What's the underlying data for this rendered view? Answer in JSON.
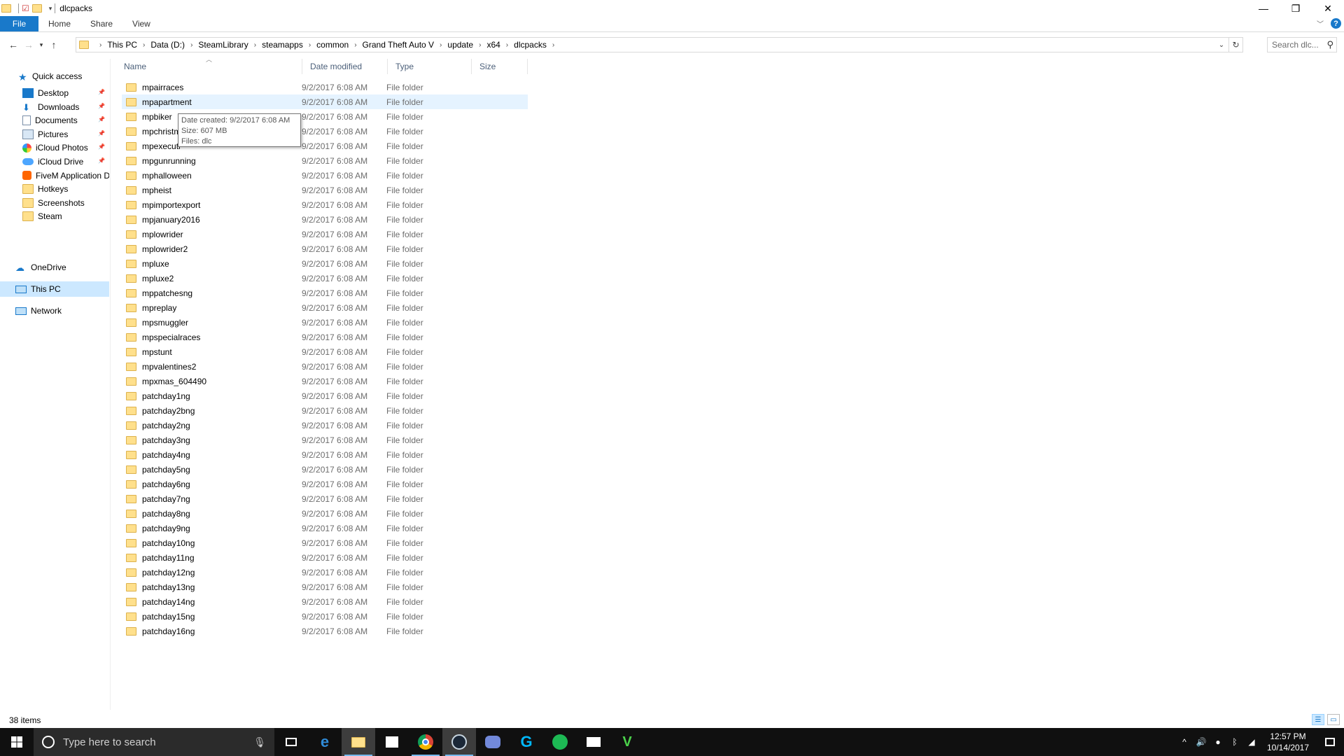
{
  "window": {
    "title": "dlcpacks",
    "controls": {
      "minimize": "—",
      "maximize": "❐",
      "close": "✕"
    }
  },
  "ribbon": {
    "tabs": [
      "File",
      "Home",
      "Share",
      "View"
    ],
    "help": "?"
  },
  "address": {
    "crumbs": [
      "This PC",
      "Data (D:)",
      "SteamLibrary",
      "steamapps",
      "common",
      "Grand Theft Auto V",
      "update",
      "x64",
      "dlcpacks"
    ],
    "search_placeholder": "Search dlc..."
  },
  "nav": {
    "quick_access": "Quick access",
    "pinned": [
      {
        "label": "Desktop",
        "icon": "desktop-icon",
        "pinned": true
      },
      {
        "label": "Downloads",
        "icon": "downloads-icon",
        "pinned": true
      },
      {
        "label": "Documents",
        "icon": "documents-icon",
        "pinned": true
      },
      {
        "label": "Pictures",
        "icon": "pictures-icon",
        "pinned": true
      },
      {
        "label": "iCloud Photos",
        "icon": "icloud-photos-icon",
        "pinned": true
      },
      {
        "label": "iCloud Drive",
        "icon": "icloud-drive-icon",
        "pinned": true
      },
      {
        "label": "FiveM Application D",
        "icon": "fivem-icon",
        "pinned": false
      },
      {
        "label": "Hotkeys",
        "icon": "folder-icon",
        "pinned": false
      },
      {
        "label": "Screenshots",
        "icon": "folder-icon",
        "pinned": false
      },
      {
        "label": "Steam",
        "icon": "folder-icon",
        "pinned": false
      }
    ],
    "onedrive": "OneDrive",
    "this_pc": "This PC",
    "network": "Network"
  },
  "columns": {
    "name": "Name",
    "date": "Date modified",
    "type": "Type",
    "size": "Size"
  },
  "files": [
    {
      "name": "mpairraces",
      "date": "9/2/2017 6:08 AM",
      "type": "File folder"
    },
    {
      "name": "mpapartment",
      "date": "9/2/2017 6:08 AM",
      "type": "File folder"
    },
    {
      "name": "mpbiker",
      "date": "9/2/2017 6:08 AM",
      "type": "File folder"
    },
    {
      "name": "mpchristm",
      "date": "9/2/2017 6:08 AM",
      "type": "File folder"
    },
    {
      "name": "mpexecuti",
      "date": "9/2/2017 6:08 AM",
      "type": "File folder"
    },
    {
      "name": "mpgunrunning",
      "date": "9/2/2017 6:08 AM",
      "type": "File folder"
    },
    {
      "name": "mphalloween",
      "date": "9/2/2017 6:08 AM",
      "type": "File folder"
    },
    {
      "name": "mpheist",
      "date": "9/2/2017 6:08 AM",
      "type": "File folder"
    },
    {
      "name": "mpimportexport",
      "date": "9/2/2017 6:08 AM",
      "type": "File folder"
    },
    {
      "name": "mpjanuary2016",
      "date": "9/2/2017 6:08 AM",
      "type": "File folder"
    },
    {
      "name": "mplowrider",
      "date": "9/2/2017 6:08 AM",
      "type": "File folder"
    },
    {
      "name": "mplowrider2",
      "date": "9/2/2017 6:08 AM",
      "type": "File folder"
    },
    {
      "name": "mpluxe",
      "date": "9/2/2017 6:08 AM",
      "type": "File folder"
    },
    {
      "name": "mpluxe2",
      "date": "9/2/2017 6:08 AM",
      "type": "File folder"
    },
    {
      "name": "mppatchesng",
      "date": "9/2/2017 6:08 AM",
      "type": "File folder"
    },
    {
      "name": "mpreplay",
      "date": "9/2/2017 6:08 AM",
      "type": "File folder"
    },
    {
      "name": "mpsmuggler",
      "date": "9/2/2017 6:08 AM",
      "type": "File folder"
    },
    {
      "name": "mpspecialraces",
      "date": "9/2/2017 6:08 AM",
      "type": "File folder"
    },
    {
      "name": "mpstunt",
      "date": "9/2/2017 6:08 AM",
      "type": "File folder"
    },
    {
      "name": "mpvalentines2",
      "date": "9/2/2017 6:08 AM",
      "type": "File folder"
    },
    {
      "name": "mpxmas_604490",
      "date": "9/2/2017 6:08 AM",
      "type": "File folder"
    },
    {
      "name": "patchday1ng",
      "date": "9/2/2017 6:08 AM",
      "type": "File folder"
    },
    {
      "name": "patchday2bng",
      "date": "9/2/2017 6:08 AM",
      "type": "File folder"
    },
    {
      "name": "patchday2ng",
      "date": "9/2/2017 6:08 AM",
      "type": "File folder"
    },
    {
      "name": "patchday3ng",
      "date": "9/2/2017 6:08 AM",
      "type": "File folder"
    },
    {
      "name": "patchday4ng",
      "date": "9/2/2017 6:08 AM",
      "type": "File folder"
    },
    {
      "name": "patchday5ng",
      "date": "9/2/2017 6:08 AM",
      "type": "File folder"
    },
    {
      "name": "patchday6ng",
      "date": "9/2/2017 6:08 AM",
      "type": "File folder"
    },
    {
      "name": "patchday7ng",
      "date": "9/2/2017 6:08 AM",
      "type": "File folder"
    },
    {
      "name": "patchday8ng",
      "date": "9/2/2017 6:08 AM",
      "type": "File folder"
    },
    {
      "name": "patchday9ng",
      "date": "9/2/2017 6:08 AM",
      "type": "File folder"
    },
    {
      "name": "patchday10ng",
      "date": "9/2/2017 6:08 AM",
      "type": "File folder"
    },
    {
      "name": "patchday11ng",
      "date": "9/2/2017 6:08 AM",
      "type": "File folder"
    },
    {
      "name": "patchday12ng",
      "date": "9/2/2017 6:08 AM",
      "type": "File folder"
    },
    {
      "name": "patchday13ng",
      "date": "9/2/2017 6:08 AM",
      "type": "File folder"
    },
    {
      "name": "patchday14ng",
      "date": "9/2/2017 6:08 AM",
      "type": "File folder"
    },
    {
      "name": "patchday15ng",
      "date": "9/2/2017 6:08 AM",
      "type": "File folder"
    },
    {
      "name": "patchday16ng",
      "date": "9/2/2017 6:08 AM",
      "type": "File folder"
    }
  ],
  "hovered_row": "mpapartment",
  "tooltip": {
    "line1": "Date created: 9/2/2017 6:08 AM",
    "line2": "Size: 607 MB",
    "line3": "Files: dlc"
  },
  "status": {
    "item_count": "38 items"
  },
  "taskbar": {
    "search_placeholder": "Type here to search",
    "apps": [
      "task-view-icon",
      "edge-icon",
      "file-explorer-icon",
      "store-icon",
      "chrome-icon",
      "steam-icon",
      "discord-icon",
      "logitech-icon",
      "spotify-icon",
      "mail-icon",
      "gta-icon"
    ],
    "time": "12:57 PM",
    "date": "10/14/2017"
  },
  "colors": {
    "accent": "#1979ca",
    "selection": "#cce8ff",
    "hover": "#e5f3ff",
    "folder": "#ffe08c",
    "taskbar": "#101010"
  }
}
